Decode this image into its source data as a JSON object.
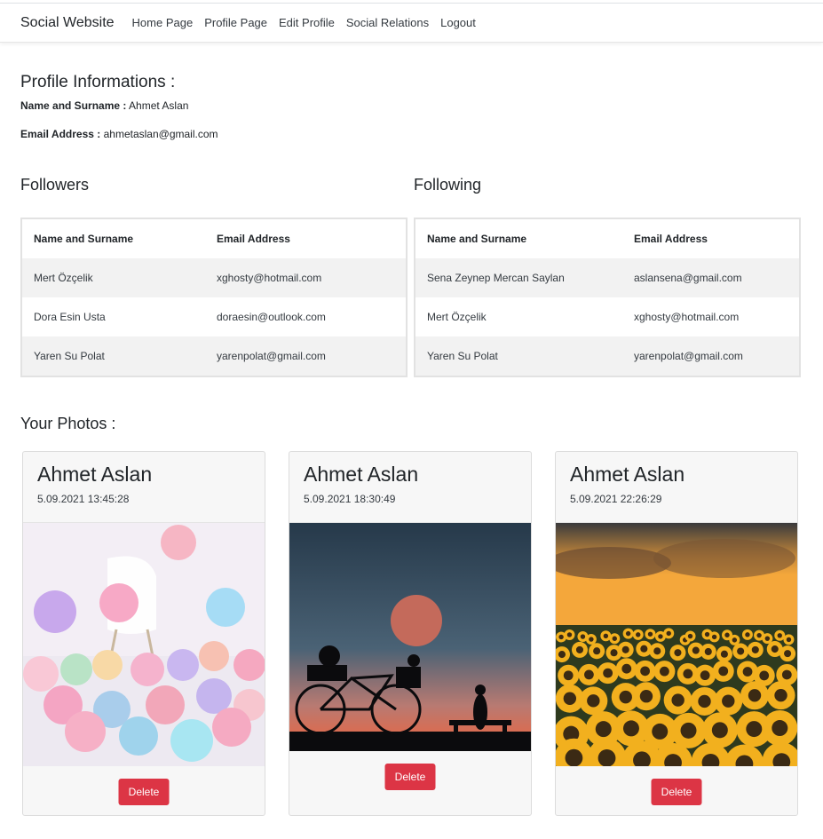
{
  "nav": {
    "brand": "Social Website",
    "links": [
      "Home Page",
      "Profile Page",
      "Edit Profile",
      "Social Relations",
      "Logout"
    ]
  },
  "profile": {
    "heading": "Profile Informations :",
    "name_label": "Name and Surname :",
    "name_value": "Ahmet Aslan",
    "email_label": "Email Address :",
    "email_value": "ahmetaslan@gmail.com"
  },
  "followers": {
    "title": "Followers",
    "headers": [
      "Name and Surname",
      "Email Address"
    ],
    "rows": [
      [
        "Mert Özçelik",
        "xghosty@hotmail.com"
      ],
      [
        "Dora Esin Usta",
        "doraesin@outlook.com"
      ],
      [
        "Yaren Su Polat",
        "yarenpolat@gmail.com"
      ]
    ]
  },
  "following": {
    "title": "Following",
    "headers": [
      "Name and Surname",
      "Email Address"
    ],
    "rows": [
      [
        "Sena Zeynep Mercan Saylan",
        "aslansena@gmail.com"
      ],
      [
        "Mert Özçelik",
        "xghosty@hotmail.com"
      ],
      [
        "Yaren Su Polat",
        "yarenpolat@gmail.com"
      ]
    ]
  },
  "photos": {
    "heading": "Your Photos :",
    "cards": [
      {
        "author": "Ahmet Aslan",
        "date": "5.09.2021 13:45:28",
        "image": "pastel-balloons-photo",
        "delete_label": "Delete"
      },
      {
        "author": "Ahmet Aslan",
        "date": "5.09.2021 18:30:49",
        "image": "bicycle-moon-silhouette-photo",
        "delete_label": "Delete"
      },
      {
        "author": "Ahmet Aslan",
        "date": "5.09.2021 22:26:29",
        "image": "sunflower-field-sunset-photo",
        "delete_label": "Delete"
      }
    ]
  },
  "colors": {
    "delete_button": "#dc3545",
    "stripe": "#f2f2f2",
    "card_bg": "#f7f7f7"
  }
}
